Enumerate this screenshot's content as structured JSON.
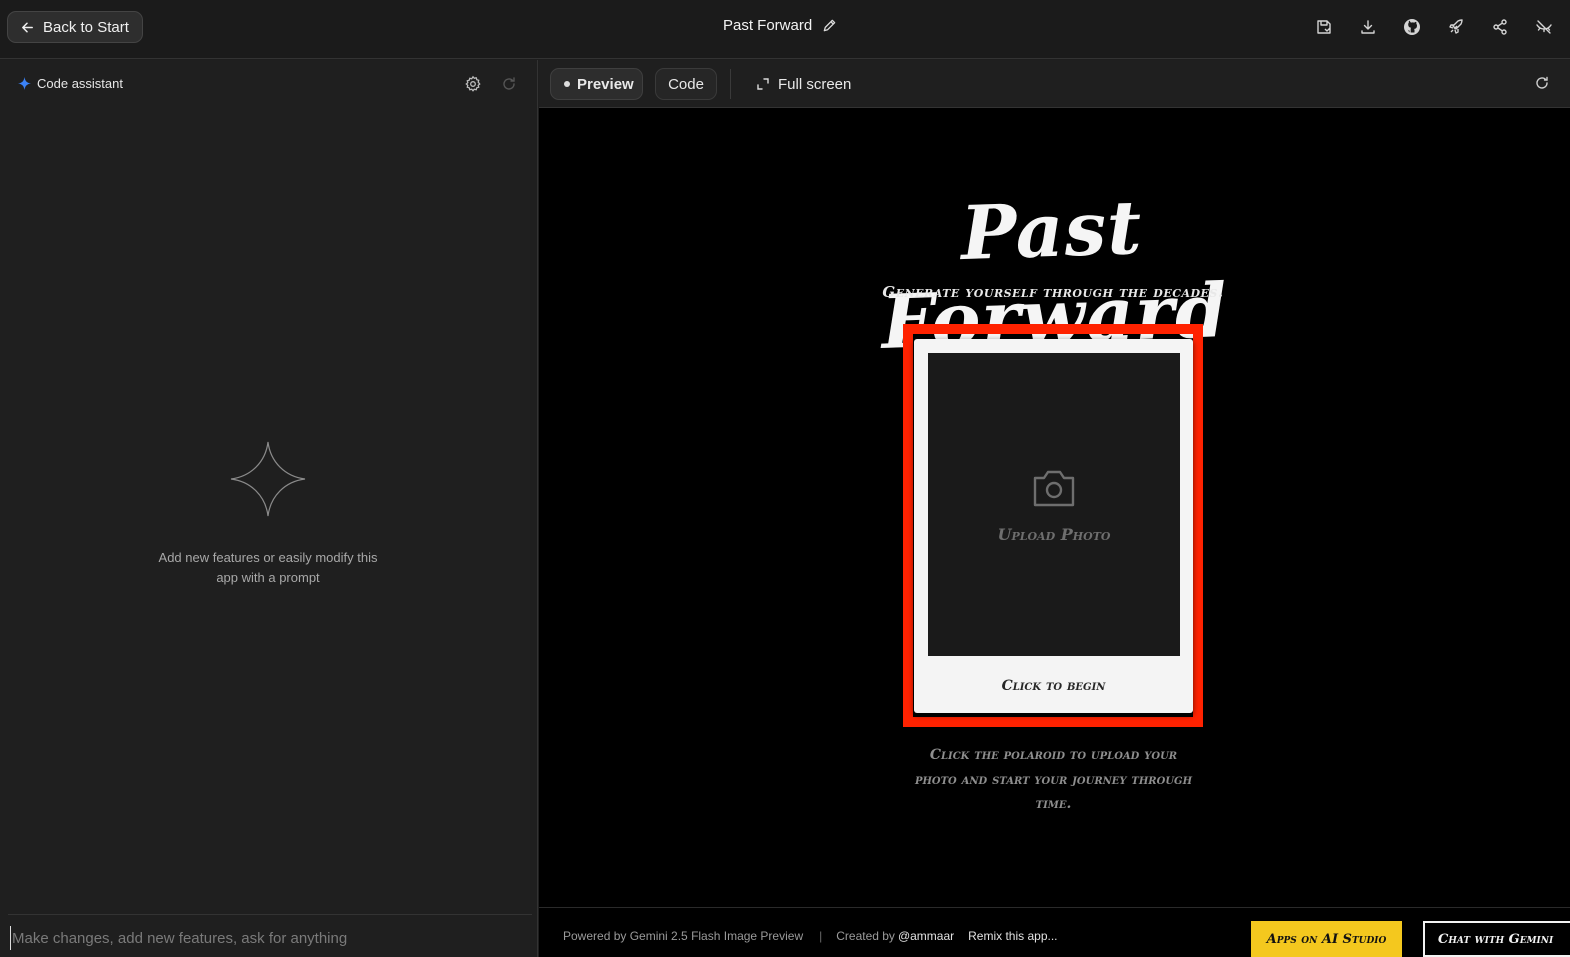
{
  "topbar": {
    "back_label": "Back to Start",
    "app_title": "Past Forward",
    "icons": [
      "save-icon",
      "download-icon",
      "github-icon",
      "deploy-rocket-icon",
      "share-icon",
      "hide-icon"
    ]
  },
  "assistant": {
    "label": "Code assistant",
    "empty_text": "Add new features or easily modify this app with a prompt",
    "prompt_placeholder": "Make changes, add new features, ask for anything"
  },
  "preview_toolbar": {
    "preview_tab": "Preview",
    "code_tab": "Code",
    "fullscreen_label": "Full screen"
  },
  "app": {
    "title": "Past Forward",
    "subtitle": "Generate yourself through the decades.",
    "upload_label": "Upload Photo",
    "polaroid_caption": "Click to begin",
    "hint": "Click the polaroid to upload your photo and start your journey through time."
  },
  "footer": {
    "powered_by": "Powered by Gemini 2.5 Flash Image Preview",
    "separator": "|",
    "created_by": "Created by",
    "handle": "@ammaar",
    "remix": "Remix this app...",
    "apps_button": "Apps on AI Studio",
    "chat_button": "Chat with Gemini"
  },
  "colors": {
    "highlight_border": "#ff2200",
    "apps_button_bg": "#f4c81e",
    "assistant_accent": "#3b82f6"
  }
}
